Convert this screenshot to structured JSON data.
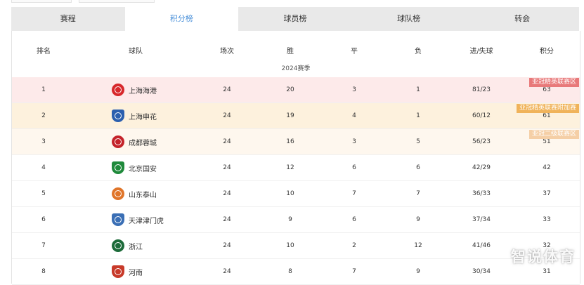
{
  "tabs": [
    "赛程",
    "积分榜",
    "球员榜",
    "球队榜",
    "转会"
  ],
  "active_tab": 1,
  "header": {
    "rank": "排名",
    "team": "球队",
    "played": "场次",
    "win": "胜",
    "draw": "平",
    "loss": "负",
    "goals": "进/失球",
    "points": "积分"
  },
  "season_label": "2024赛季",
  "zone_colors": {
    "afc_elite": "#e8797a",
    "afc_elite_playoff": "#f0b35a",
    "afc_two": "#f5cfa6"
  },
  "row_colors": {
    "afc_elite": "#fdeaea",
    "afc_elite_playoff": "#fdf1dd",
    "afc_two": "#fef7ee",
    "none": "#ffffff"
  },
  "rows": [
    {
      "rank": "1",
      "team": "上海海港",
      "played": "24",
      "win": "20",
      "draw": "3",
      "loss": "1",
      "goals": "81/23",
      "points": "63",
      "zone": "afc_elite",
      "zone_label": "亚冠精英联赛区",
      "logo_color": "#d7282b",
      "logo_icon": "shanghai-port-logo-icon"
    },
    {
      "rank": "2",
      "team": "上海申花",
      "played": "24",
      "win": "19",
      "draw": "4",
      "loss": "1",
      "goals": "60/12",
      "points": "61",
      "zone": "afc_elite_playoff",
      "zone_label": "亚冠精英联赛附加赛",
      "logo_color": "#2b5fae",
      "logo_icon": "shanghai-shenhua-logo-icon"
    },
    {
      "rank": "3",
      "team": "成都蓉城",
      "played": "24",
      "win": "16",
      "draw": "3",
      "loss": "5",
      "goals": "56/23",
      "points": "51",
      "zone": "afc_two",
      "zone_label": "亚冠二级联赛区",
      "logo_color": "#c4232a",
      "logo_icon": "chengdu-rongcheng-logo-icon"
    },
    {
      "rank": "4",
      "team": "北京国安",
      "played": "24",
      "win": "12",
      "draw": "6",
      "loss": "6",
      "goals": "42/29",
      "points": "42",
      "zone": "none",
      "zone_label": "",
      "logo_color": "#1f8a3b",
      "logo_icon": "beijing-guoan-logo-icon"
    },
    {
      "rank": "5",
      "team": "山东泰山",
      "played": "24",
      "win": "10",
      "draw": "7",
      "loss": "7",
      "goals": "36/33",
      "points": "37",
      "zone": "none",
      "zone_label": "",
      "logo_color": "#e0752a",
      "logo_icon": "shandong-taishan-logo-icon"
    },
    {
      "rank": "6",
      "team": "天津津门虎",
      "played": "24",
      "win": "9",
      "draw": "6",
      "loss": "9",
      "goals": "37/34",
      "points": "33",
      "zone": "none",
      "zone_label": "",
      "logo_color": "#3a6fb5",
      "logo_icon": "tianjin-jinmen-tiger-logo-icon"
    },
    {
      "rank": "7",
      "team": "浙江",
      "played": "24",
      "win": "10",
      "draw": "2",
      "loss": "12",
      "goals": "41/46",
      "points": "32",
      "zone": "none",
      "zone_label": "",
      "logo_color": "#1d6b3a",
      "logo_icon": "zhejiang-logo-icon"
    },
    {
      "rank": "8",
      "team": "河南",
      "played": "24",
      "win": "8",
      "draw": "7",
      "loss": "9",
      "goals": "30/34",
      "points": "31",
      "zone": "none",
      "zone_label": "",
      "logo_color": "#c83a2a",
      "logo_icon": "henan-logo-icon"
    }
  ],
  "watermark": "智说体育"
}
